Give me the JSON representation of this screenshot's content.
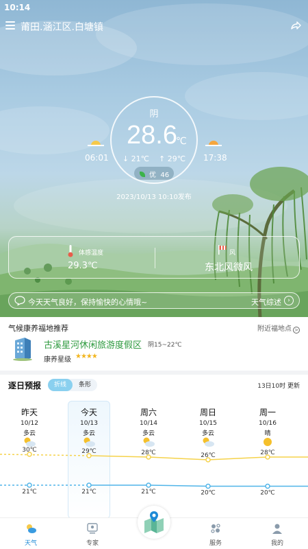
{
  "status_bar": {
    "time": "10:14"
  },
  "header": {
    "location": "莆田.涵江区.白塘镇"
  },
  "current": {
    "condition": "阴",
    "temperature": "28.6",
    "unit": "℃",
    "low": "↓ 21℃",
    "high": "↑ 29℃",
    "aqi_label": "优",
    "aqi_value": "46",
    "sunrise": "06:01",
    "sunset": "17:38",
    "published": "2023/10/13 10:10发布"
  },
  "cards": {
    "feel_label": "体感温度",
    "feel_value": "29.3℃",
    "wind_label": "风",
    "wind_value": "东北风微风"
  },
  "tip": {
    "text": "今天天气良好，保持愉快的心情哦~",
    "link": "天气综述",
    "arrow": "›"
  },
  "recommend": {
    "title": "气候康养福地推荐",
    "link": "附近福地点",
    "link_icon": ">",
    "spot_name": "古溪星河休闲旅游度假区",
    "spot_temp": "阴15~22℃",
    "level_label": "康养星级",
    "stars": "★★★★",
    "star_color": "#f2b51e"
  },
  "forecast": {
    "title": "逐日预报",
    "mode_line": "折线",
    "mode_bar": "条形",
    "update": "13日10时 更新",
    "days": [
      {
        "name": "昨天",
        "date": "10/12",
        "cond": "多云",
        "icon": "partly-cloudy-icon",
        "high": "30℃",
        "low": "21℃"
      },
      {
        "name": "今天",
        "date": "10/13",
        "cond": "多云",
        "icon": "partly-cloudy-icon",
        "high": "29℃",
        "low": "21℃"
      },
      {
        "name": "周六",
        "date": "10/14",
        "cond": "多云",
        "icon": "partly-cloudy-icon",
        "high": "28℃",
        "low": "21℃"
      },
      {
        "name": "周日",
        "date": "10/15",
        "cond": "多云",
        "icon": "partly-cloudy-icon",
        "high": "26℃",
        "low": "20℃"
      },
      {
        "name": "周一",
        "date": "10/16",
        "cond": "晴",
        "icon": "sunny-icon",
        "high": "28℃",
        "low": "20℃"
      }
    ],
    "high_color": "#f5d24a",
    "low_color": "#4fb4e8"
  },
  "tabs": [
    {
      "label": "天气",
      "icon": "weather-icon",
      "active": true
    },
    {
      "label": "专家",
      "icon": "expert-icon",
      "active": false
    },
    {
      "label": "",
      "icon": "map-icon",
      "active": false
    },
    {
      "label": "服务",
      "icon": "service-icon",
      "active": false
    },
    {
      "label": "我的",
      "icon": "profile-icon",
      "active": false
    }
  ],
  "colors": {
    "active_tab": "#1e8ad6",
    "accent_green": "#2e9a3f"
  }
}
